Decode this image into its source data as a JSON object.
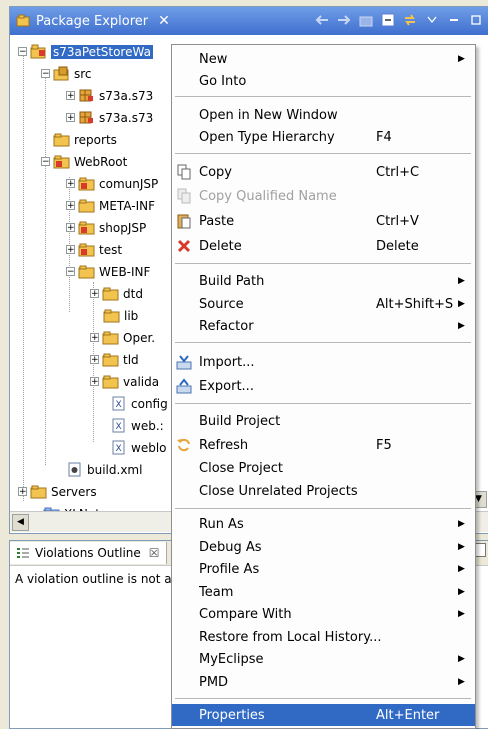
{
  "package_explorer": {
    "tab_title": "Package Explorer",
    "tree": {
      "project": "s73aPetStoreWa",
      "src": "src",
      "src_pkg1": "s73a.s73",
      "src_pkg2": "s73a.s73",
      "reports": "reports",
      "webroot": "WebRoot",
      "comunjsp": "comunJSP",
      "metainf": "META-INF",
      "shopjsp": "shopJSP",
      "test": "test",
      "webinf": "WEB-INF",
      "dtd": "dtd",
      "lib": "lib",
      "oper": "Oper.",
      "tld": "tld",
      "valida": "valida",
      "config": "config",
      "webxml": "web.:",
      "weblo": "weblo",
      "buildxml": "build.xml",
      "servers": "Servers",
      "xlnets": "XLNets"
    }
  },
  "violations_outline": {
    "tab_title": "Violations Outline",
    "message": "A violation outline is not a"
  },
  "context_menu": {
    "new": "New",
    "go_into": "Go Into",
    "open_new_window": "Open in New Window",
    "open_type_hierarchy": "Open Type Hierarchy",
    "open_type_hierarchy_key": "F4",
    "copy": "Copy",
    "copy_key": "Ctrl+C",
    "copy_qualified": "Copy Qualified Name",
    "paste": "Paste",
    "paste_key": "Ctrl+V",
    "delete": "Delete",
    "delete_key": "Delete",
    "build_path": "Build Path",
    "source": "Source",
    "source_key": "Alt+Shift+S",
    "refactor": "Refactor",
    "import": "Import...",
    "export": "Export...",
    "build_project": "Build Project",
    "refresh": "Refresh",
    "refresh_key": "F5",
    "close_project": "Close Project",
    "close_unrelated": "Close Unrelated Projects",
    "run_as": "Run As",
    "debug_as": "Debug As",
    "profile_as": "Profile As",
    "team": "Team",
    "compare_with": "Compare With",
    "restore_history": "Restore from Local History...",
    "myeclipse": "MyEclipse",
    "pmd": "PMD",
    "properties": "Properties",
    "properties_key": "Alt+Enter"
  },
  "colors": {
    "selection": "#316ac5",
    "view_header": "#3f6fcf",
    "folder": "#f2c44f",
    "error_marker": "#d83a2b"
  }
}
